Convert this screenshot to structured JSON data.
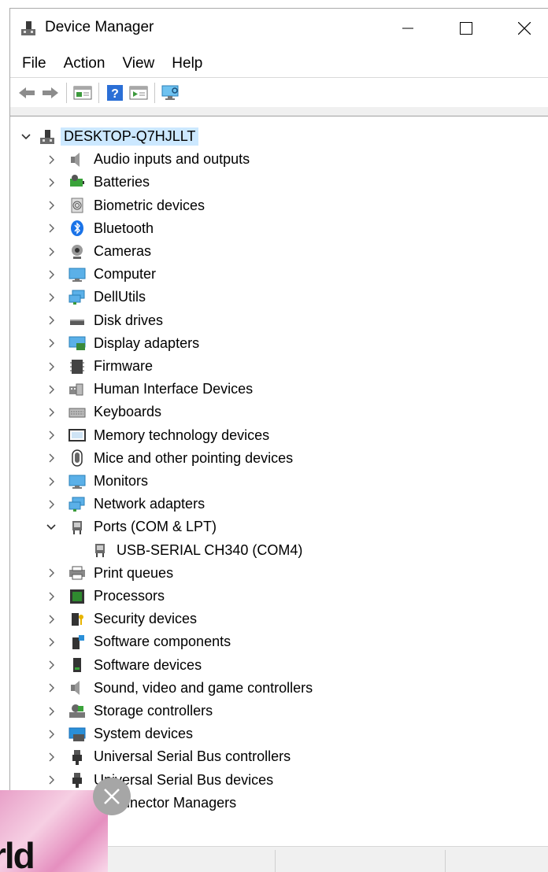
{
  "window": {
    "title": "Device Manager",
    "controls": [
      "minimize",
      "maximize",
      "close"
    ]
  },
  "menu": [
    "File",
    "Action",
    "View",
    "Help"
  ],
  "toolbar": {
    "buttons": [
      "back-icon",
      "forward-icon",
      "properties-icon",
      "help-icon",
      "run-icon",
      "monitor-scan-icon"
    ]
  },
  "tree": {
    "root": "DESKTOP-Q7HJLLT",
    "items": [
      {
        "label": "Audio inputs and outputs",
        "icon": "speaker-icon",
        "expanded": false
      },
      {
        "label": "Batteries",
        "icon": "battery-icon",
        "expanded": false
      },
      {
        "label": "Biometric devices",
        "icon": "fingerprint-icon",
        "expanded": false
      },
      {
        "label": "Bluetooth",
        "icon": "bluetooth-icon",
        "expanded": false
      },
      {
        "label": "Cameras",
        "icon": "camera-icon",
        "expanded": false
      },
      {
        "label": "Computer",
        "icon": "computer-icon",
        "expanded": false
      },
      {
        "label": "DellUtils",
        "icon": "network-monitor-icon",
        "expanded": false
      },
      {
        "label": "Disk drives",
        "icon": "disk-drive-icon",
        "expanded": false
      },
      {
        "label": "Display adapters",
        "icon": "display-adapter-icon",
        "expanded": false
      },
      {
        "label": "Firmware",
        "icon": "firmware-icon",
        "expanded": false
      },
      {
        "label": "Human Interface Devices",
        "icon": "hid-icon",
        "expanded": false
      },
      {
        "label": "Keyboards",
        "icon": "keyboard-icon",
        "expanded": false
      },
      {
        "label": "Memory technology devices",
        "icon": "memory-icon",
        "expanded": false
      },
      {
        "label": "Mice and other pointing devices",
        "icon": "mouse-icon",
        "expanded": false
      },
      {
        "label": "Monitors",
        "icon": "monitor-icon",
        "expanded": false
      },
      {
        "label": "Network adapters",
        "icon": "network-adapter-icon",
        "expanded": false
      },
      {
        "label": "Ports (COM & LPT)",
        "icon": "port-icon",
        "expanded": true
      },
      {
        "label": "USB-SERIAL CH340 (COM4)",
        "icon": "port-icon",
        "child": true
      },
      {
        "label": "Print queues",
        "icon": "printer-icon",
        "expanded": false
      },
      {
        "label": "Processors",
        "icon": "processor-icon",
        "expanded": false
      },
      {
        "label": "Security devices",
        "icon": "security-icon",
        "expanded": false
      },
      {
        "label": "Software components",
        "icon": "software-component-icon",
        "expanded": false
      },
      {
        "label": "Software devices",
        "icon": "software-device-icon",
        "expanded": false
      },
      {
        "label": "Sound, video and game controllers",
        "icon": "speaker-icon",
        "expanded": false
      },
      {
        "label": "Storage controllers",
        "icon": "storage-controller-icon",
        "expanded": false
      },
      {
        "label": "System devices",
        "icon": "system-device-icon",
        "expanded": false
      },
      {
        "label": "Universal Serial Bus controllers",
        "icon": "usb-icon",
        "expanded": false
      },
      {
        "label": "Universal Serial Bus devices",
        "icon": "usb-icon",
        "expanded": false
      },
      {
        "label": "Connector Managers",
        "icon": "usb-icon",
        "expanded": false,
        "partial_label": "onnector Managers"
      }
    ]
  },
  "ad": {
    "text": "rld"
  },
  "colors": {
    "selection": "#cce8ff",
    "toolbar_bg": "#f0f0f0",
    "monitor_blue": "#1e90d8"
  }
}
